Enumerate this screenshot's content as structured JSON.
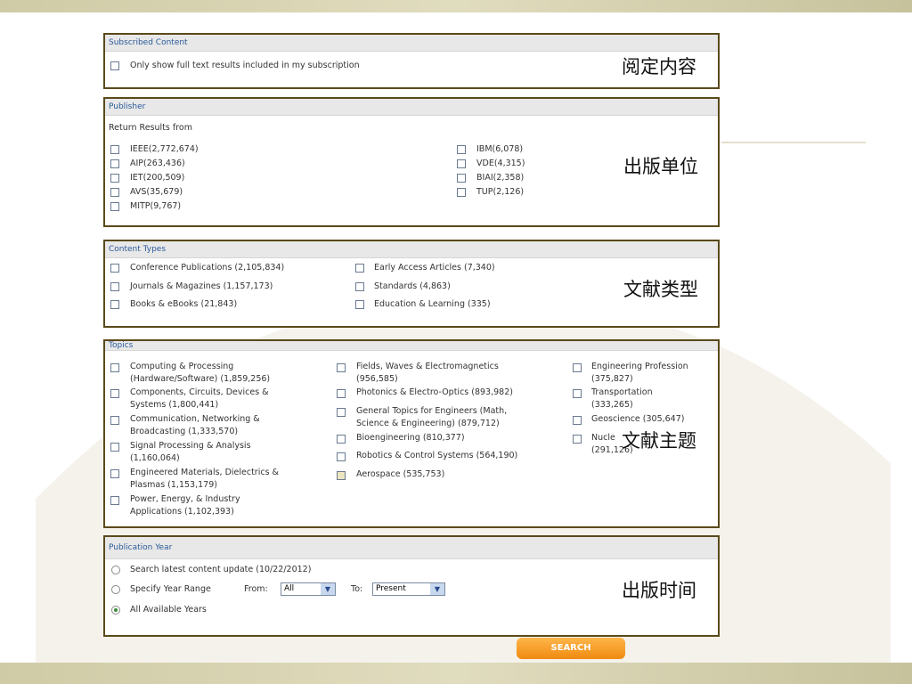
{
  "subscribed": {
    "header": "Subscribed Content",
    "option": "Only show full text results included in my subscription",
    "cn_label": "阅定内容"
  },
  "publisher": {
    "header": "Publisher",
    "intro": "Return Results from",
    "left": [
      "IEEE(2,772,674)",
      "AIP(263,436)",
      "IET(200,509)",
      "AVS(35,679)",
      "MITP(9,767)"
    ],
    "right": [
      "IBM(6,078)",
      "VDE(4,315)",
      "BIAI(2,358)",
      "TUP(2,126)"
    ],
    "cn_label": "出版单位"
  },
  "content_types": {
    "header": "Content Types",
    "left": [
      "Conference Publications (2,105,834)",
      "Journals & Magazines (1,157,173)",
      "Books & eBooks (21,843)"
    ],
    "right": [
      "Early Access Articles (7,340)",
      "Standards (4,863)",
      "Education & Learning (335)"
    ],
    "cn_label": "文献类型"
  },
  "topics": {
    "header": "Topics",
    "col1": [
      [
        "Computing & Processing",
        "(Hardware/Software) (1,859,256)"
      ],
      [
        "Components, Circuits, Devices &",
        "Systems (1,800,441)"
      ],
      [
        "Communication, Networking &",
        "Broadcasting (1,333,570)"
      ],
      [
        "Signal Processing & Analysis",
        "(1,160,064)"
      ],
      [
        "Engineered Materials, Dielectrics &",
        "Plasmas (1,153,179)"
      ],
      [
        "Power, Energy, & Industry",
        "Applications (1,102,393)"
      ]
    ],
    "col2": [
      [
        "Fields, Waves & Electromagnetics",
        "(956,585)"
      ],
      [
        "Photonics & Electro-Optics (893,982)",
        ""
      ],
      [
        "General Topics for Engineers (Math,",
        "Science & Engineering) (879,712)"
      ],
      [
        "Bioengineering (810,377)",
        ""
      ],
      [
        "Robotics & Control Systems (564,190)",
        ""
      ],
      [
        "Aerospace (535,753)",
        ""
      ]
    ],
    "col3": [
      [
        "Engineering Profession",
        "(375,827)"
      ],
      [
        "Transportation",
        "(333,265)"
      ],
      [
        "Geoscience (305,647)",
        ""
      ],
      [
        "Nucle",
        "(291,126)"
      ]
    ],
    "cn_label": "文献主题"
  },
  "pub_year": {
    "header": "Publication Year",
    "opt_latest": "Search latest content update (10/22/2012)",
    "opt_range": "Specify Year Range",
    "from_label": "From:",
    "from_value": "All",
    "to_label": "To:",
    "to_value": "Present",
    "opt_all": "All Available Years",
    "cn_label": "出版时间"
  },
  "search_button": "SEARCH",
  "icons": {
    "dropdown": "chevron-down-icon"
  }
}
